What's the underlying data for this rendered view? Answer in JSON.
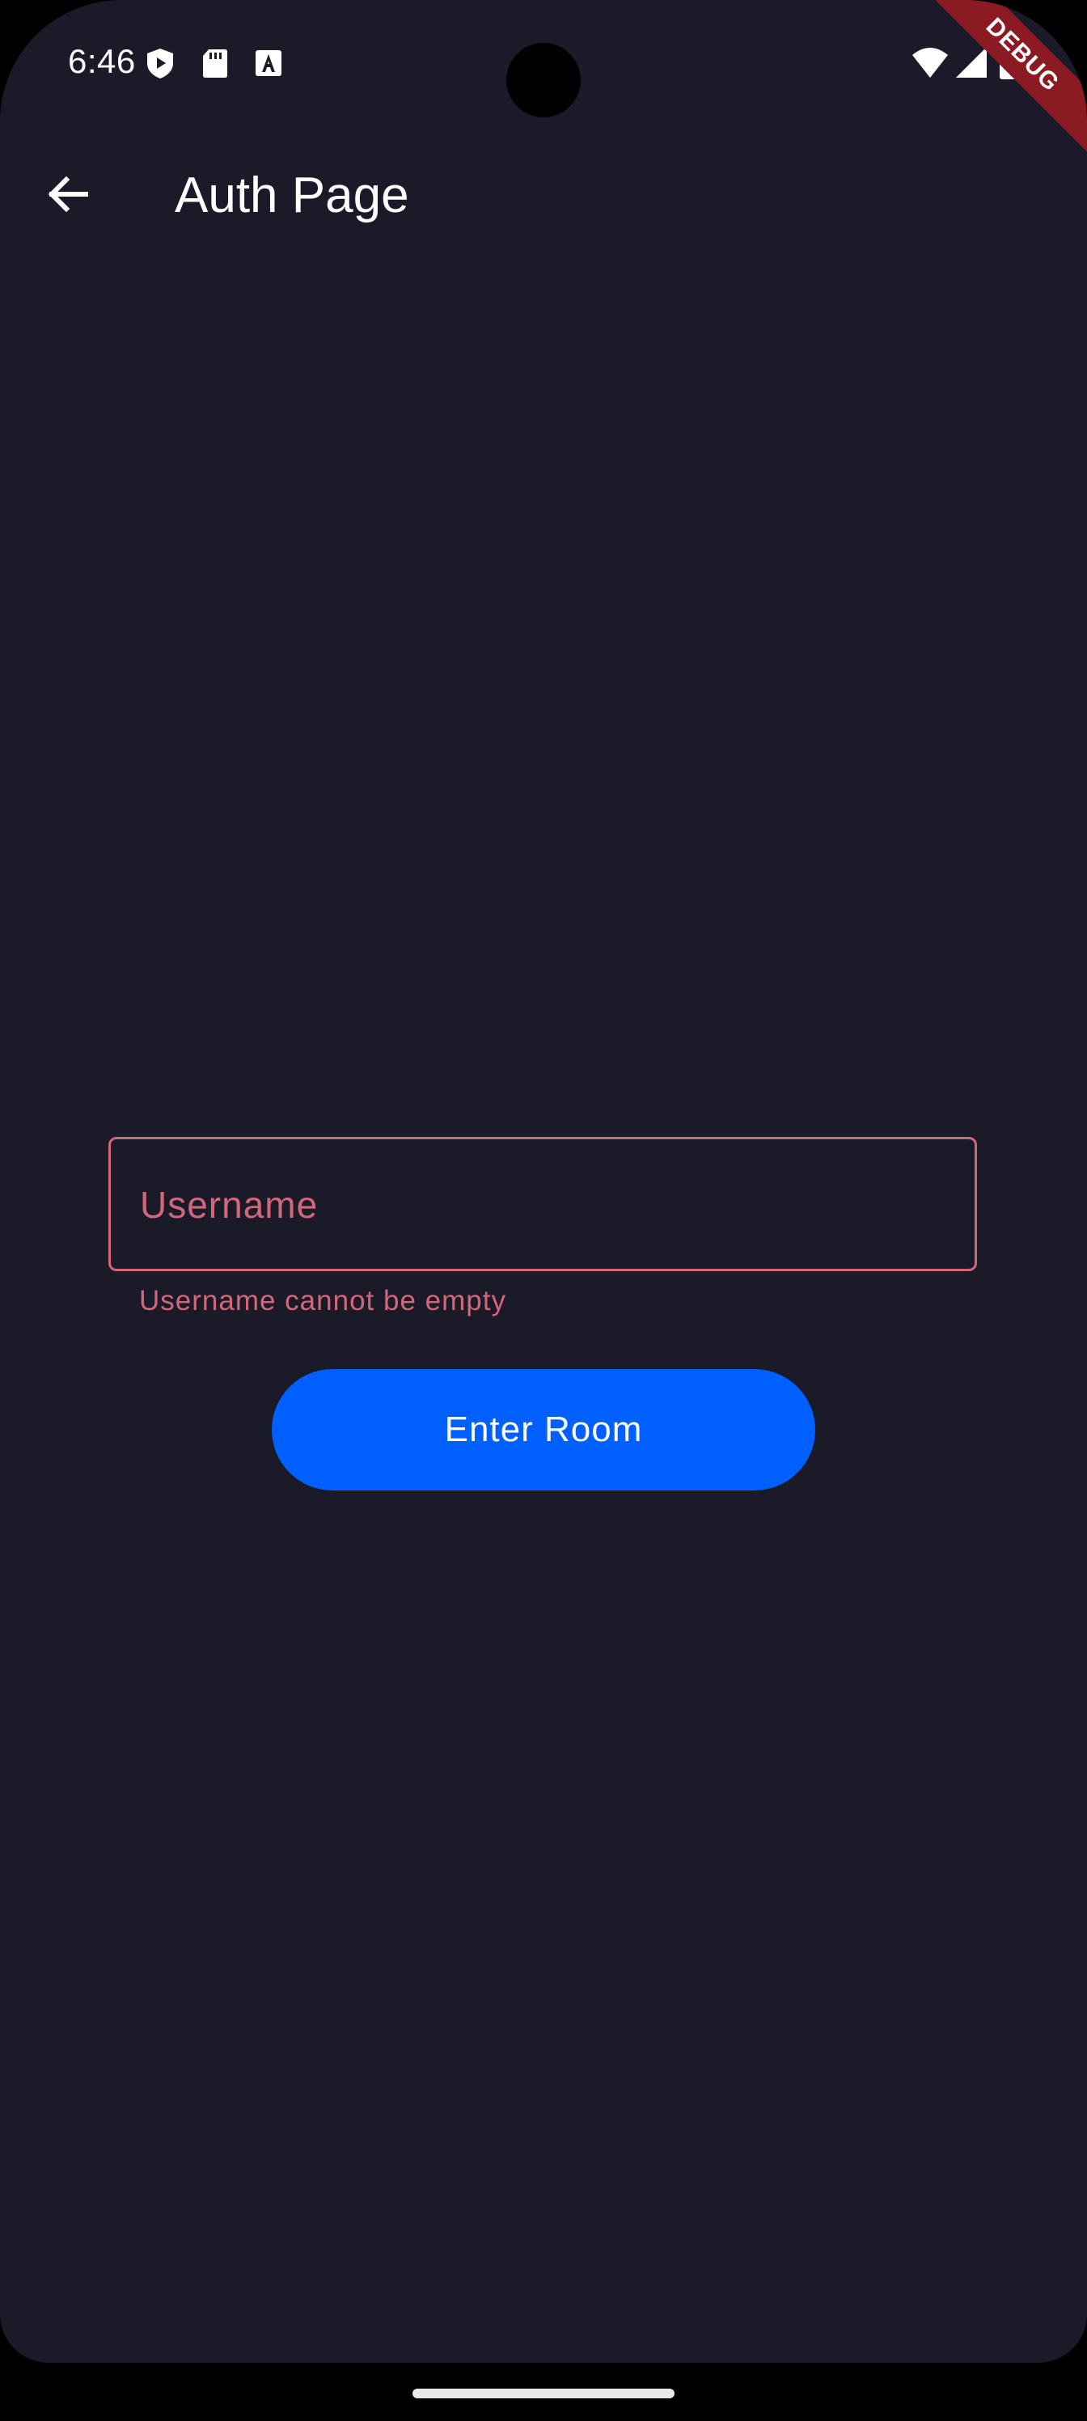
{
  "status_bar": {
    "time": "6:46",
    "left_icons": [
      "shield-play-icon",
      "sd-card-icon",
      "font-a-icon"
    ],
    "right_icons": [
      "wifi-icon",
      "cellular-signal-icon",
      "battery-icon"
    ]
  },
  "debug_banner": {
    "label": "DEBUG",
    "color": "#8b1a22"
  },
  "app_bar": {
    "back_icon": "arrow-back-icon",
    "title": "Auth Page"
  },
  "form": {
    "username": {
      "placeholder": "Username",
      "value": "",
      "error": "Username cannot be empty",
      "error_color": "#d4667a"
    },
    "submit_label": "Enter Room",
    "submit_color": "#0060ff"
  },
  "theme": {
    "background": "#1a1a29"
  }
}
